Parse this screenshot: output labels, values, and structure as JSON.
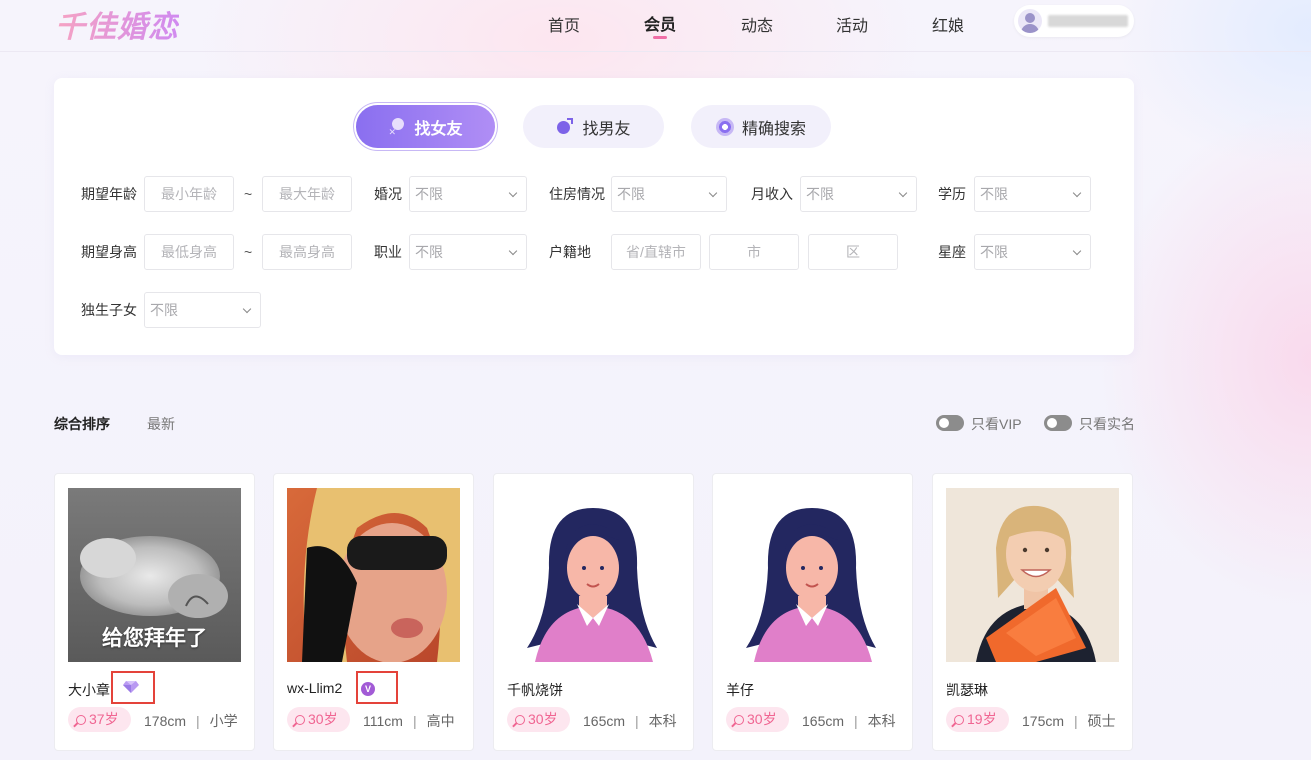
{
  "brand": {
    "logo": "千佳婚恋",
    "accent": "#f06ea6",
    "purple": "#8a6ff0"
  },
  "nav": {
    "items": [
      {
        "label": "首页",
        "active": false
      },
      {
        "label": "会员",
        "active": true
      },
      {
        "label": "动态",
        "active": false
      },
      {
        "label": "活动",
        "active": false
      },
      {
        "label": "红娘",
        "active": false
      }
    ]
  },
  "user": {
    "icon": "user-avatar-icon"
  },
  "search": {
    "modes": [
      {
        "label": "找女友",
        "icon": "female-icon",
        "active": true
      },
      {
        "label": "找男友",
        "icon": "male-icon",
        "active": false
      },
      {
        "label": "精确搜索",
        "icon": "target-icon",
        "active": false
      }
    ],
    "fields": {
      "age_label": "期望年龄",
      "age_min_placeholder": "最小年龄",
      "age_max_placeholder": "最大年龄",
      "height_label": "期望身高",
      "height_min_placeholder": "最低身高",
      "height_max_placeholder": "最高身高",
      "tilde": "~",
      "marriage_label": "婚况",
      "marriage_value": "不限",
      "housing_label": "住房情况",
      "housing_value": "不限",
      "income_label": "月收入",
      "income_value": "不限",
      "education_label": "学历",
      "education_value": "不限",
      "job_label": "职业",
      "job_value": "不限",
      "hukou_label": "户籍地",
      "province_placeholder": "省/直辖市",
      "city_placeholder": "市",
      "district_placeholder": "区",
      "zodiac_label": "星座",
      "zodiac_value": "不限",
      "only_child_label": "独生子女",
      "only_child_value": "不限"
    }
  },
  "sorting": {
    "options": [
      {
        "label": "综合排序",
        "active": true
      },
      {
        "label": "最新",
        "active": false
      }
    ]
  },
  "filters": {
    "only_vip": "只看VIP",
    "only_verified": "只看实名"
  },
  "members": [
    {
      "name": "大小章",
      "badge": "diamond-icon",
      "age": "37岁",
      "height": "178cm",
      "education": "小学",
      "photo_caption": "给您拜年了"
    },
    {
      "name": "wx-Llim2",
      "badge": "verified-v-icon",
      "age": "30岁",
      "height": "111cm",
      "education": "高中"
    },
    {
      "name": "千帆烧饼",
      "age": "30岁",
      "height": "165cm",
      "education": "本科"
    },
    {
      "name": "羊仔",
      "age": "30岁",
      "height": "165cm",
      "education": "本科"
    },
    {
      "name": "凯瑟琳",
      "age": "19岁",
      "height": "175cm",
      "education": "硕士"
    }
  ],
  "meta_separator": "|"
}
